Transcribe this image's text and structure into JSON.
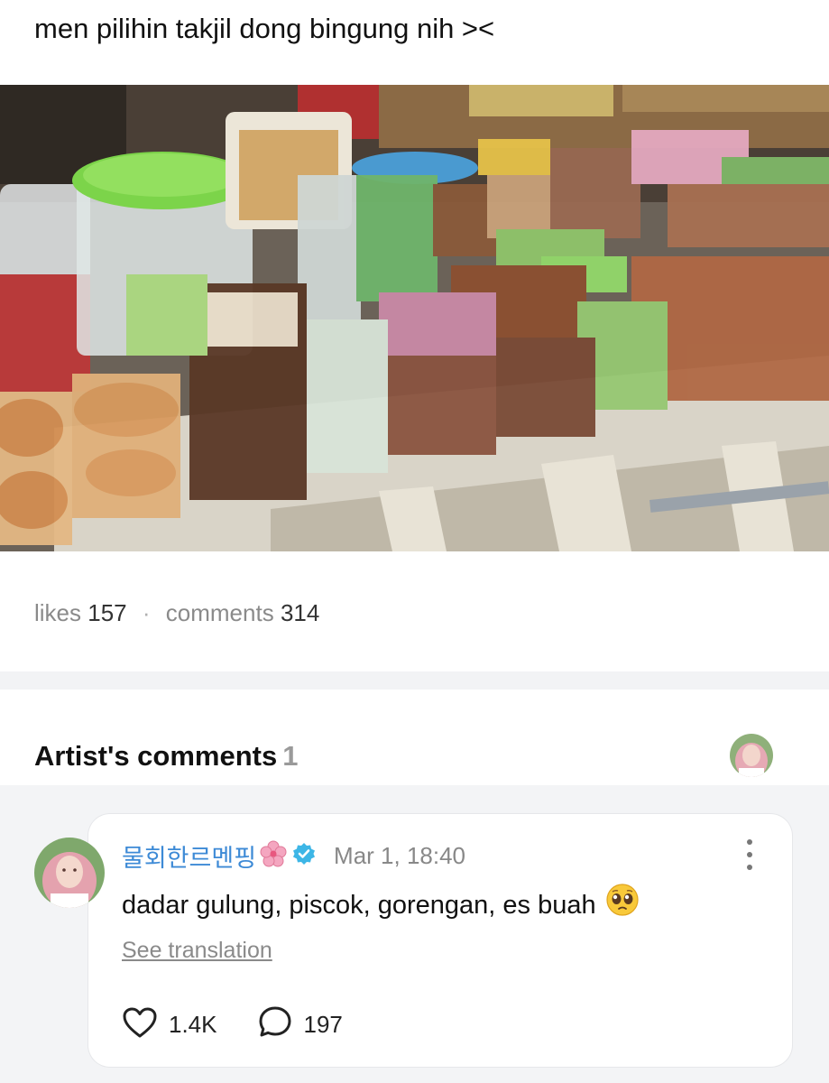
{
  "post": {
    "text": "men pilihin takjil dong bingung nih ><",
    "likes_label": "likes",
    "likes_count": "157",
    "comments_label": "comments",
    "comments_count": "314",
    "separator": "·"
  },
  "artist_comments": {
    "title": "Artist's comments",
    "count": "1"
  },
  "comment": {
    "author": "물회한르멘핑",
    "date": "Mar 1, 18:40",
    "text": "dadar gulung, piscok, gorengan, es buah",
    "see_translation": "See translation",
    "likes": "1.4K",
    "replies": "197"
  },
  "colors": {
    "author": "#3d8ad6",
    "verified": "#3db6e6",
    "muted": "#8a8a8a",
    "section_bg": "#f3f4f6"
  },
  "icons": [
    "flower-icon",
    "verified-badge-icon",
    "more-options-icon",
    "heart-icon",
    "comment-bubble-icon",
    "pleading-face-emoji"
  ]
}
